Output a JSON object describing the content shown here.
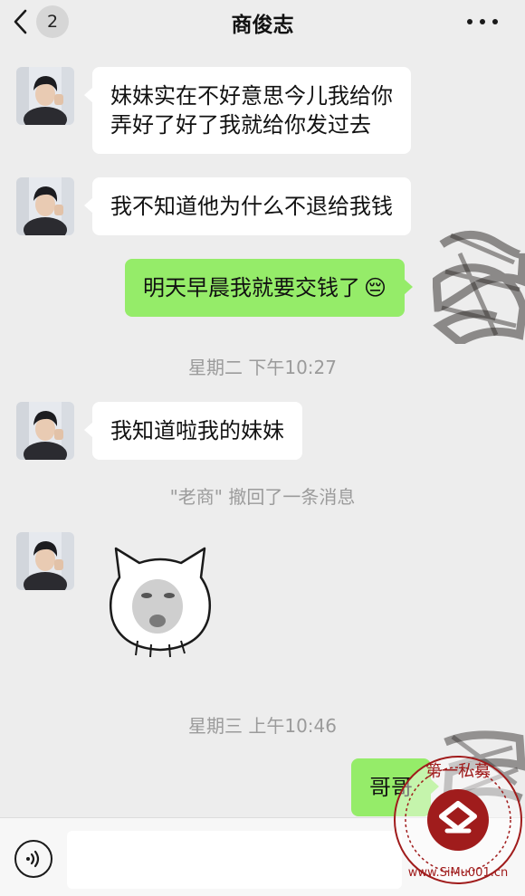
{
  "header": {
    "title": "商俊志",
    "unread_count": "2"
  },
  "messages": [
    {
      "side": "left",
      "lines": [
        "妹妹实在不好意思今儿我给你",
        "弄好了好了我就给你发过去"
      ]
    },
    {
      "side": "left",
      "lines": [
        "我不知道他为什么不退给我钱"
      ]
    },
    {
      "side": "right",
      "lines": [
        "明天早晨我就要交钱了"
      ],
      "emoji": "😔"
    },
    {
      "side": "left",
      "lines": [
        "我知道啦我的妹妹"
      ]
    },
    {
      "side": "left",
      "type": "sticker"
    },
    {
      "side": "right",
      "lines": [
        "哥哥"
      ]
    }
  ],
  "timestamps": [
    "星期二 下午10:27",
    "星期三 上午10:46"
  ],
  "system_notice": "\"老商\" 撤回了一条消息",
  "watermark": {
    "text": "第一私募 www.SiMu001.cn",
    "color": "#a01c1c"
  },
  "colors": {
    "background": "#ededed",
    "bubble_self": "#95ec69",
    "bubble_other": "#ffffff"
  },
  "footer": {
    "input_value": ""
  }
}
